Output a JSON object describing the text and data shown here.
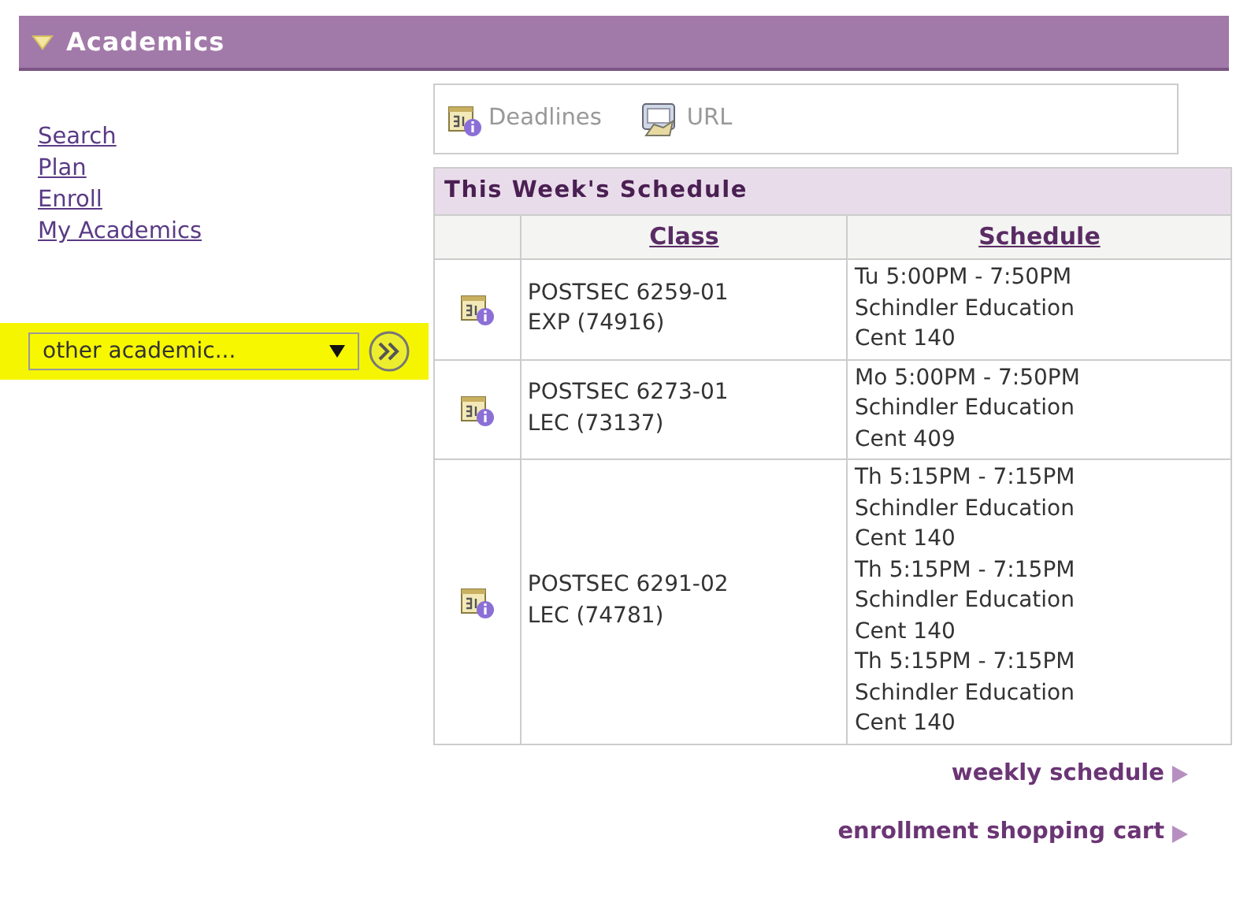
{
  "header": {
    "title": "Academics",
    "expanded": true
  },
  "nav_links": [
    "Search",
    "Plan",
    "Enroll",
    "My Academics"
  ],
  "dropdown": {
    "value": "other academic...",
    "highlighted": true
  },
  "toolbar": [
    {
      "label": "Deadlines",
      "kind": "calendar"
    },
    {
      "label": "URL",
      "kind": "url"
    }
  ],
  "schedule": {
    "title": "This Week's Schedule",
    "columns": [
      "Class",
      "Schedule"
    ],
    "rows": [
      {
        "class": [
          "POSTSEC 6259-01",
          "EXP (74916)"
        ],
        "schedule": [
          "Tu 5:00PM - 7:50PM",
          "Schindler Education",
          "Cent 140"
        ]
      },
      {
        "class": [
          "POSTSEC 6273-01",
          "LEC (73137)"
        ],
        "schedule": [
          "Mo 5:00PM - 7:50PM",
          "Schindler Education",
          "Cent 409"
        ]
      },
      {
        "class": [
          "POSTSEC 6291-02",
          "LEC (74781)"
        ],
        "schedule": [
          "Th 5:15PM - 7:15PM",
          "Schindler Education",
          "Cent 140",
          "Th 5:15PM - 7:15PM",
          "Schindler Education",
          "Cent 140",
          "Th 5:15PM - 7:15PM",
          "Schindler Education",
          "Cent 140"
        ]
      }
    ]
  },
  "footer_links": [
    "weekly schedule",
    "enrollment shopping cart"
  ]
}
